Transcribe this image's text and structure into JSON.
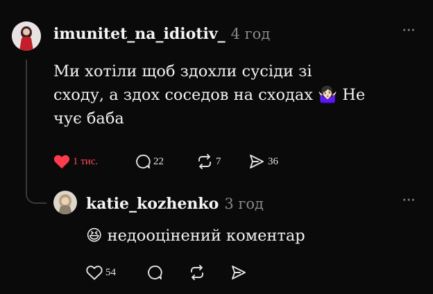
{
  "comment": {
    "username": "imunitet_na_idiotiv_",
    "time": "4 год",
    "more_label": "···",
    "text_line1": "Ми хотіли щоб здохли сусіди зі",
    "text_line2": "сходу, а здох соседов на сходах",
    "emoji_shrug": "🤷🏻‍♀️",
    "text_line2_after": "Не",
    "text_line3": "чує баба",
    "actions": {
      "likes": "1 тис.",
      "comments": "22",
      "reposts": "7",
      "shares": "36"
    },
    "colors": {
      "like": "#ff4b57"
    }
  },
  "reply": {
    "username": "katie_kozhenko",
    "time": "3 год",
    "more_label": "···",
    "emoji": "😆",
    "text": "недооцінений коментар",
    "actions": {
      "likes": "54"
    }
  }
}
